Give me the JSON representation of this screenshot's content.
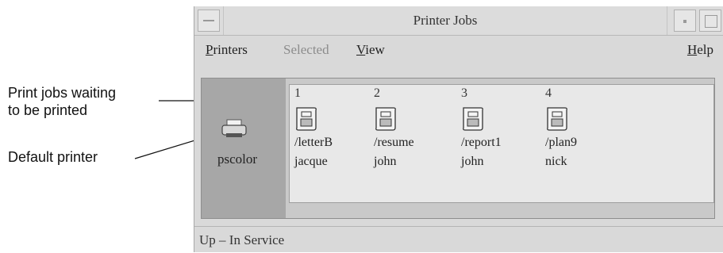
{
  "annotations": {
    "jobs_callout_line1": "Print jobs waiting",
    "jobs_callout_line2": "to be printed",
    "printer_callout": "Default printer"
  },
  "window": {
    "title": "Printer Jobs"
  },
  "menubar": {
    "printers": {
      "mnemonic": "P",
      "rest": "rinters"
    },
    "selected": {
      "label": "Selected",
      "enabled": false
    },
    "view": {
      "mnemonic": "V",
      "rest": "iew"
    },
    "help": {
      "mnemonic": "H",
      "rest": "elp"
    }
  },
  "printer": {
    "name": "pscolor",
    "icon": "printer-icon"
  },
  "jobs": [
    {
      "number": "1",
      "file": "/letterB",
      "owner": "jacque",
      "icon": "print-job-icon"
    },
    {
      "number": "2",
      "file": "/resume",
      "owner": "john",
      "icon": "print-job-icon"
    },
    {
      "number": "3",
      "file": "/report1",
      "owner": "john",
      "icon": "print-job-icon"
    },
    {
      "number": "4",
      "file": "/plan9",
      "owner": "nick",
      "icon": "print-job-icon"
    }
  ],
  "status": {
    "text": "Up – In Service"
  }
}
